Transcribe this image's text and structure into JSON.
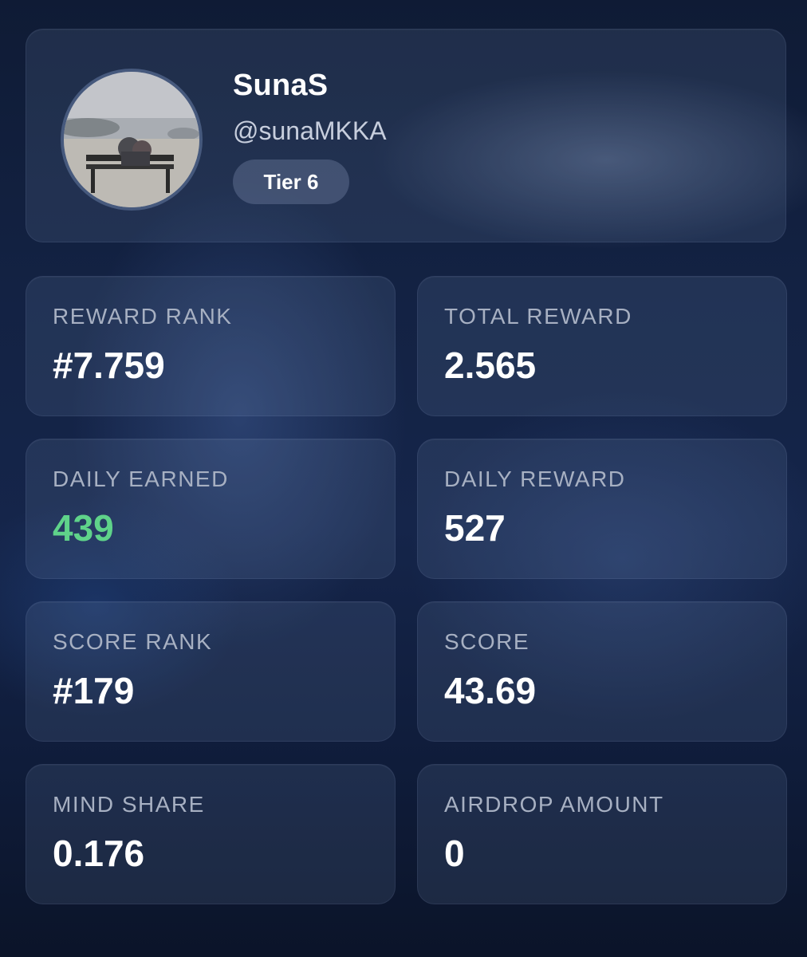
{
  "profile": {
    "name": "SunaS",
    "handle": "@sunaMKKA",
    "tier": "Tier 6"
  },
  "colors": {
    "positive": "#5fd38a",
    "value": "#ffffff",
    "label": "#a7b0c2"
  },
  "stats": [
    {
      "label": "REWARD RANK",
      "value": "#7.759"
    },
    {
      "label": "TOTAL REWARD",
      "value": "2.565"
    },
    {
      "label": "DAILY EARNED",
      "value": "439"
    },
    {
      "label": "DAILY REWARD",
      "value": "527"
    },
    {
      "label": "SCORE RANK",
      "value": "#179"
    },
    {
      "label": "SCORE",
      "value": "43.69"
    },
    {
      "label": "MIND SHARE",
      "value": "0.176"
    },
    {
      "label": "AIRDROP AMOUNT",
      "value": "0"
    }
  ]
}
